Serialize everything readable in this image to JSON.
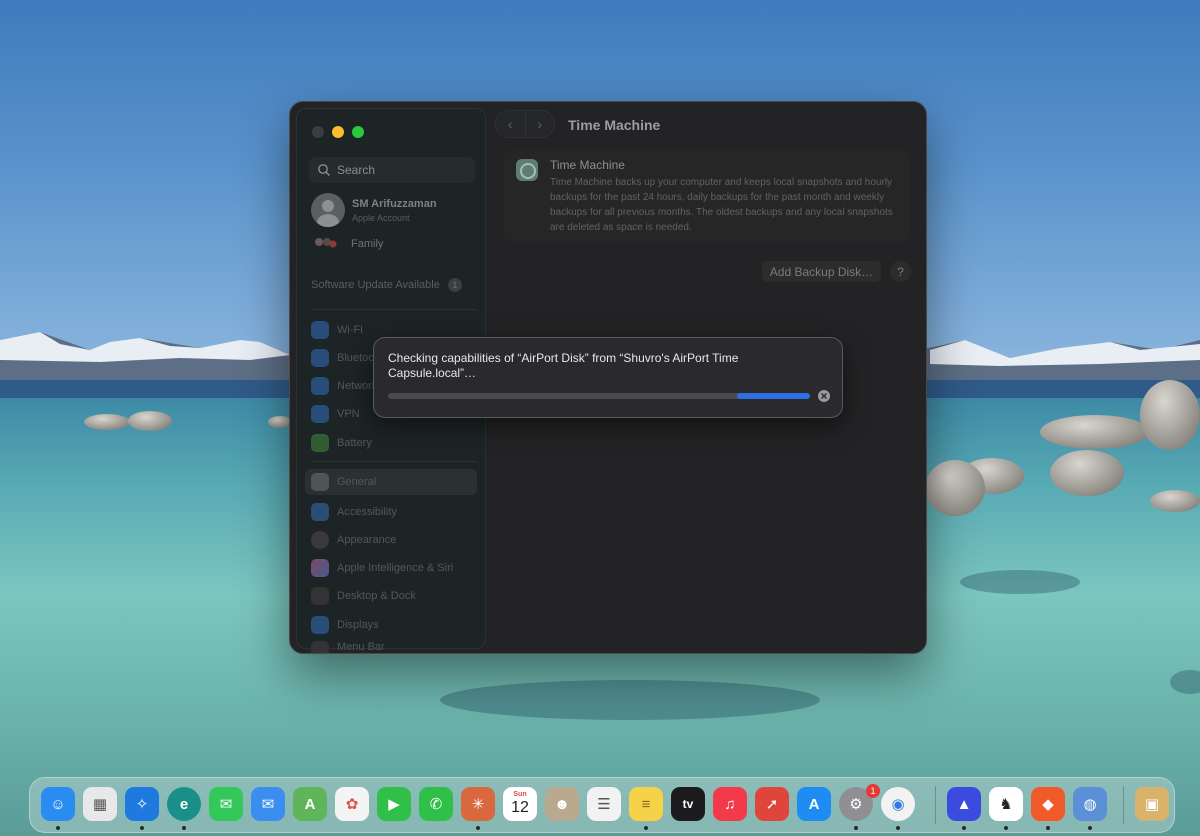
{
  "window": {
    "title": "Time Machine"
  },
  "sidebar": {
    "search_placeholder": "Search",
    "account_name": "SM Arifuzzaman",
    "account_sub": "Apple Account",
    "family_label": "Family",
    "update_label": "Software Update Available",
    "update_count": "1",
    "items": [
      {
        "label": "Wi-Fi",
        "color": "#2d5a8e"
      },
      {
        "label": "Bluetooth",
        "color": "#2d5a8e"
      },
      {
        "label": "Network",
        "color": "#2d5a8e"
      },
      {
        "label": "VPN",
        "color": "#2d5a8e"
      },
      {
        "label": "Battery",
        "color": "#3a6a3a"
      },
      {
        "label": "General",
        "color": "#5a5f61"
      },
      {
        "label": "Accessibility",
        "color": "#2d5a8e"
      },
      {
        "label": "Appearance",
        "color": "#3a3a3a"
      },
      {
        "label": "Apple Intelligence & Siri",
        "color": "#8a4a6a"
      },
      {
        "label": "Desktop & Dock",
        "color": "#3a3a3a"
      },
      {
        "label": "Displays",
        "color": "#2d5a8e"
      },
      {
        "label": "Menu Bar",
        "color": "#3a3a3a"
      }
    ]
  },
  "content": {
    "card_title": "Time Machine",
    "card_description": "Time Machine backs up your computer and keeps local snapshots and hourly backups for the past 24 hours, daily backups for the past month and weekly backups for all previous months. The oldest backups and any local snapshots are deleted as space is needed.",
    "add_backup_label": "Add Backup Disk…",
    "help_label": "?"
  },
  "dialog": {
    "message": "Checking capabilities of “AirPort Disk” from “Shuvro's AirPort Time Capsule.local”…",
    "progress_accent": "#2f6fe4"
  },
  "dock": {
    "calendar_month": "Sun",
    "calendar_day": "12",
    "tv_label": "tv",
    "settings_badge": "1",
    "apps": [
      {
        "name": "finder-icon",
        "color": "#2a8cf0",
        "glyph": "☺"
      },
      {
        "name": "launchpad-icon",
        "color": "#e8e8ea",
        "glyph": "▦"
      },
      {
        "name": "safari-icon",
        "color": "#1f7ae0",
        "glyph": "✧"
      },
      {
        "name": "edge-icon",
        "color": "#1a8f8a",
        "glyph": "e"
      },
      {
        "name": "messages-icon",
        "color": "#34c759",
        "glyph": "✉"
      },
      {
        "name": "mail-icon",
        "color": "#3a8ef0",
        "glyph": "✉"
      },
      {
        "name": "maps-icon",
        "color": "#5fb65a",
        "glyph": "A"
      },
      {
        "name": "photos-icon",
        "color": "#f4f4f4",
        "glyph": "✿"
      },
      {
        "name": "facetime-icon",
        "color": "#30c04a",
        "glyph": "▶"
      },
      {
        "name": "phone-icon",
        "color": "#30c04a",
        "glyph": "✆"
      },
      {
        "name": "claude-icon",
        "color": "#d9683f",
        "glyph": "✳"
      },
      {
        "name": "calendar-icon",
        "color": "#ffffff",
        "glyph": ""
      },
      {
        "name": "contacts-icon",
        "color": "#b9a98e",
        "glyph": "☻"
      },
      {
        "name": "reminders-icon",
        "color": "#f2f2f2",
        "glyph": "☰"
      },
      {
        "name": "notes-icon",
        "color": "#f6d249",
        "glyph": "≡"
      },
      {
        "name": "apple-tv-icon",
        "color": "#1c1c1e",
        "glyph": ""
      },
      {
        "name": "music-icon",
        "color": "#f23a4b",
        "glyph": "♫"
      },
      {
        "name": "rocket-icon",
        "color": "#e0453b",
        "glyph": "➚"
      },
      {
        "name": "app-store-icon",
        "color": "#1e8cf2",
        "glyph": "A"
      },
      {
        "name": "system-settings-icon",
        "color": "#8e8e93",
        "glyph": "⚙"
      },
      {
        "name": "chrome-icon",
        "color": "#f2f2f2",
        "glyph": "◉"
      },
      {
        "name": "proton-vpn-icon",
        "color": "#3b4be0",
        "glyph": "▲"
      },
      {
        "name": "ollama-icon",
        "color": "#ffffff",
        "glyph": "♞"
      },
      {
        "name": "brave-icon",
        "color": "#f05a28",
        "glyph": "◆"
      },
      {
        "name": "disk-utility-icon",
        "color": "#5b8fd6",
        "glyph": "◍"
      },
      {
        "name": "archive-icon",
        "color": "#d9b36a",
        "glyph": "▣"
      }
    ]
  }
}
